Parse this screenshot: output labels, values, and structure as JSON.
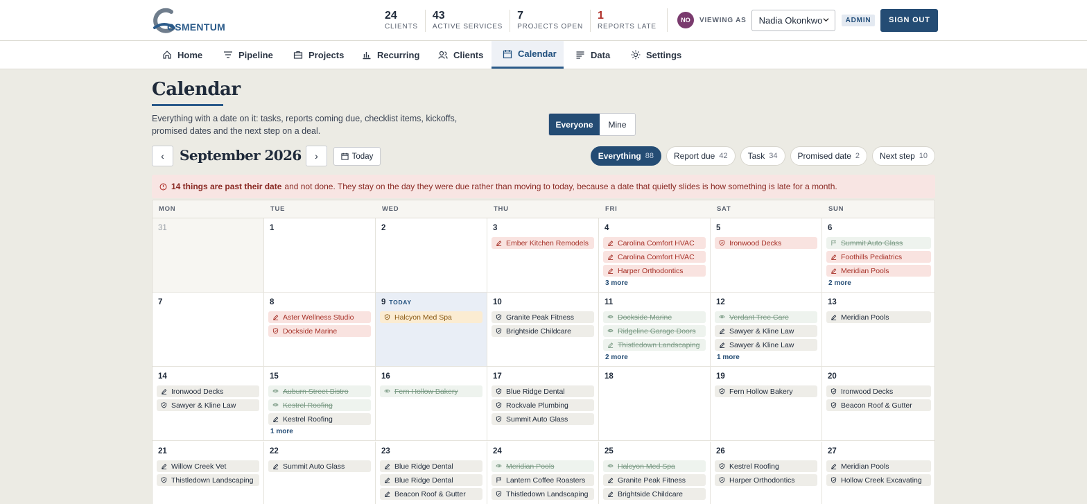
{
  "header": {
    "logo_text": "OSMENTUM",
    "stats": [
      {
        "value": "24",
        "label": "CLIENTS"
      },
      {
        "value": "43",
        "label": "ACTIVE SERVICES"
      },
      {
        "value": "7",
        "label": "PROJECTS OPEN"
      },
      {
        "value": "1",
        "label": "REPORTS LATE"
      }
    ],
    "avatar_initials": "NO",
    "viewing_as_label": "VIEWING AS",
    "viewing_as_user": "Nadia Okonkwo",
    "role_badge": "ADMIN",
    "sign_out_label": "SIGN OUT"
  },
  "nav": [
    {
      "label": "Home",
      "icon": "home-icon"
    },
    {
      "label": "Pipeline",
      "icon": "filter-icon"
    },
    {
      "label": "Projects",
      "icon": "briefcase-icon"
    },
    {
      "label": "Recurring",
      "icon": "bar-chart-icon"
    },
    {
      "label": "Clients",
      "icon": "users-icon"
    },
    {
      "label": "Calendar",
      "icon": "calendar-icon",
      "active": true
    },
    {
      "label": "Data",
      "icon": "list-icon"
    },
    {
      "label": "Settings",
      "icon": "sun-icon"
    }
  ],
  "page": {
    "title": "Calendar",
    "description": "Everything with a date on it: tasks, reports coming due, checklist items, kickoffs, promised dates and the next step on a deal.",
    "scope_options": [
      "Everyone",
      "Mine"
    ],
    "scope_selected": "Everyone",
    "month_label": "September 2026",
    "today_label": "Today",
    "prev_label": "‹",
    "next_label": "›"
  },
  "filters": [
    {
      "label": "Everything",
      "count": "88",
      "active": true
    },
    {
      "label": "Report due",
      "count": "42"
    },
    {
      "label": "Task",
      "count": "34"
    },
    {
      "label": "Promised date",
      "count": "2"
    },
    {
      "label": "Next step",
      "count": "10"
    }
  ],
  "alert": {
    "bold": "14 things are past their date",
    "rest": "and not done. They stay on the day they were due rather than moving to today, because a date that quietly slides is how something is late for a month."
  },
  "calendar": {
    "weekdays": [
      "MON",
      "TUE",
      "WED",
      "THU",
      "FRI",
      "SAT",
      "SUN"
    ],
    "today_tag": "TODAY",
    "weeks": [
      [
        {
          "day": "31",
          "other": true,
          "events": []
        },
        {
          "day": "1",
          "events": []
        },
        {
          "day": "2",
          "events": []
        },
        {
          "day": "3",
          "events": [
            {
              "name": "Ember Kitchen Remodels",
              "state": "late",
              "icon": "pen"
            }
          ]
        },
        {
          "day": "4",
          "events": [
            {
              "name": "Carolina Comfort HVAC",
              "state": "late",
              "icon": "pen"
            },
            {
              "name": "Carolina Comfort HVAC",
              "state": "late",
              "icon": "pen"
            },
            {
              "name": "Harper Orthodontics",
              "state": "late",
              "icon": "pen"
            }
          ],
          "more": "3 more"
        },
        {
          "day": "5",
          "events": [
            {
              "name": "Ironwood Decks",
              "state": "late",
              "icon": "shield"
            }
          ]
        },
        {
          "day": "6",
          "events": [
            {
              "name": "Summit Auto Glass",
              "state": "done",
              "icon": "flag"
            },
            {
              "name": "Foothills Pediatrics",
              "state": "late",
              "icon": "pen"
            },
            {
              "name": "Meridian Pools",
              "state": "late",
              "icon": "pen"
            }
          ],
          "more": "2 more"
        }
      ],
      [
        {
          "day": "7",
          "events": []
        },
        {
          "day": "8",
          "events": [
            {
              "name": "Aster Wellness Studio",
              "state": "late",
              "icon": "pen"
            },
            {
              "name": "Dockside Marine",
              "state": "late",
              "icon": "shield"
            }
          ]
        },
        {
          "day": "9",
          "today": true,
          "events": [
            {
              "name": "Halcyon Med Spa",
              "state": "soon",
              "icon": "shield"
            }
          ]
        },
        {
          "day": "10",
          "events": [
            {
              "name": "Granite Peak Fitness",
              "state": "normal",
              "icon": "shield"
            },
            {
              "name": "Brightside Childcare",
              "state": "normal",
              "icon": "shield"
            }
          ]
        },
        {
          "day": "11",
          "events": [
            {
              "name": "Dockside Marine",
              "state": "done",
              "icon": "eye"
            },
            {
              "name": "Ridgeline Garage Doors",
              "state": "done",
              "icon": "eye"
            },
            {
              "name": "Thistledown Landscaping",
              "state": "done",
              "icon": "pen"
            }
          ],
          "more": "2 more"
        },
        {
          "day": "12",
          "events": [
            {
              "name": "Verdant Tree Care",
              "state": "done",
              "icon": "eye"
            },
            {
              "name": "Sawyer & Kline Law",
              "state": "normal",
              "icon": "pen"
            },
            {
              "name": "Sawyer & Kline Law",
              "state": "normal",
              "icon": "pen"
            }
          ],
          "more": "1 more"
        },
        {
          "day": "13",
          "events": [
            {
              "name": "Meridian Pools",
              "state": "normal",
              "icon": "pen"
            }
          ]
        }
      ],
      [
        {
          "day": "14",
          "events": [
            {
              "name": "Ironwood Decks",
              "state": "normal",
              "icon": "pen"
            },
            {
              "name": "Sawyer & Kline Law",
              "state": "normal",
              "icon": "shield"
            }
          ]
        },
        {
          "day": "15",
          "events": [
            {
              "name": "Auburn Street Bistro",
              "state": "done",
              "icon": "eye"
            },
            {
              "name": "Kestrel Roofing",
              "state": "done",
              "icon": "eye"
            },
            {
              "name": "Kestrel Roofing",
              "state": "normal",
              "icon": "pen"
            }
          ],
          "more": "1 more"
        },
        {
          "day": "16",
          "events": [
            {
              "name": "Fern Hollow Bakery",
              "state": "done",
              "icon": "eye"
            }
          ]
        },
        {
          "day": "17",
          "events": [
            {
              "name": "Blue Ridge Dental",
              "state": "normal",
              "icon": "shield"
            },
            {
              "name": "Rockvale Plumbing",
              "state": "normal",
              "icon": "shield"
            },
            {
              "name": "Summit Auto Glass",
              "state": "normal",
              "icon": "shield"
            }
          ]
        },
        {
          "day": "18",
          "events": []
        },
        {
          "day": "19",
          "events": [
            {
              "name": "Fern Hollow Bakery",
              "state": "normal",
              "icon": "shield"
            }
          ]
        },
        {
          "day": "20",
          "events": [
            {
              "name": "Ironwood Decks",
              "state": "normal",
              "icon": "shield"
            },
            {
              "name": "Beacon Roof & Gutter",
              "state": "normal",
              "icon": "shield"
            }
          ]
        }
      ],
      [
        {
          "day": "21",
          "events": [
            {
              "name": "Willow Creek Vet",
              "state": "normal",
              "icon": "pen"
            },
            {
              "name": "Thistledown Landscaping",
              "state": "normal",
              "icon": "shield"
            }
          ]
        },
        {
          "day": "22",
          "events": [
            {
              "name": "Summit Auto Glass",
              "state": "normal",
              "icon": "pen"
            }
          ]
        },
        {
          "day": "23",
          "events": [
            {
              "name": "Blue Ridge Dental",
              "state": "normal",
              "icon": "pen"
            },
            {
              "name": "Blue Ridge Dental",
              "state": "normal",
              "icon": "pen"
            },
            {
              "name": "Beacon Roof & Gutter",
              "state": "normal",
              "icon": "pen"
            }
          ]
        },
        {
          "day": "24",
          "events": [
            {
              "name": "Meridian Pools",
              "state": "done",
              "icon": "eye"
            },
            {
              "name": "Lantern Coffee Roasters",
              "state": "normal",
              "icon": "flag"
            },
            {
              "name": "Thistledown Landscaping",
              "state": "normal",
              "icon": "shield"
            }
          ]
        },
        {
          "day": "25",
          "events": [
            {
              "name": "Halcyon Med Spa",
              "state": "done",
              "icon": "eye"
            },
            {
              "name": "Granite Peak Fitness",
              "state": "normal",
              "icon": "pen"
            },
            {
              "name": "Brightside Childcare",
              "state": "normal",
              "icon": "pen"
            }
          ]
        },
        {
          "day": "26",
          "events": [
            {
              "name": "Kestrel Roofing",
              "state": "normal",
              "icon": "shield"
            },
            {
              "name": "Harper Orthodontics",
              "state": "normal",
              "icon": "shield"
            }
          ]
        },
        {
          "day": "27",
          "events": [
            {
              "name": "Meridian Pools",
              "state": "normal",
              "icon": "pen"
            },
            {
              "name": "Hollow Creek Excavating",
              "state": "normal",
              "icon": "shield"
            }
          ]
        }
      ]
    ]
  }
}
